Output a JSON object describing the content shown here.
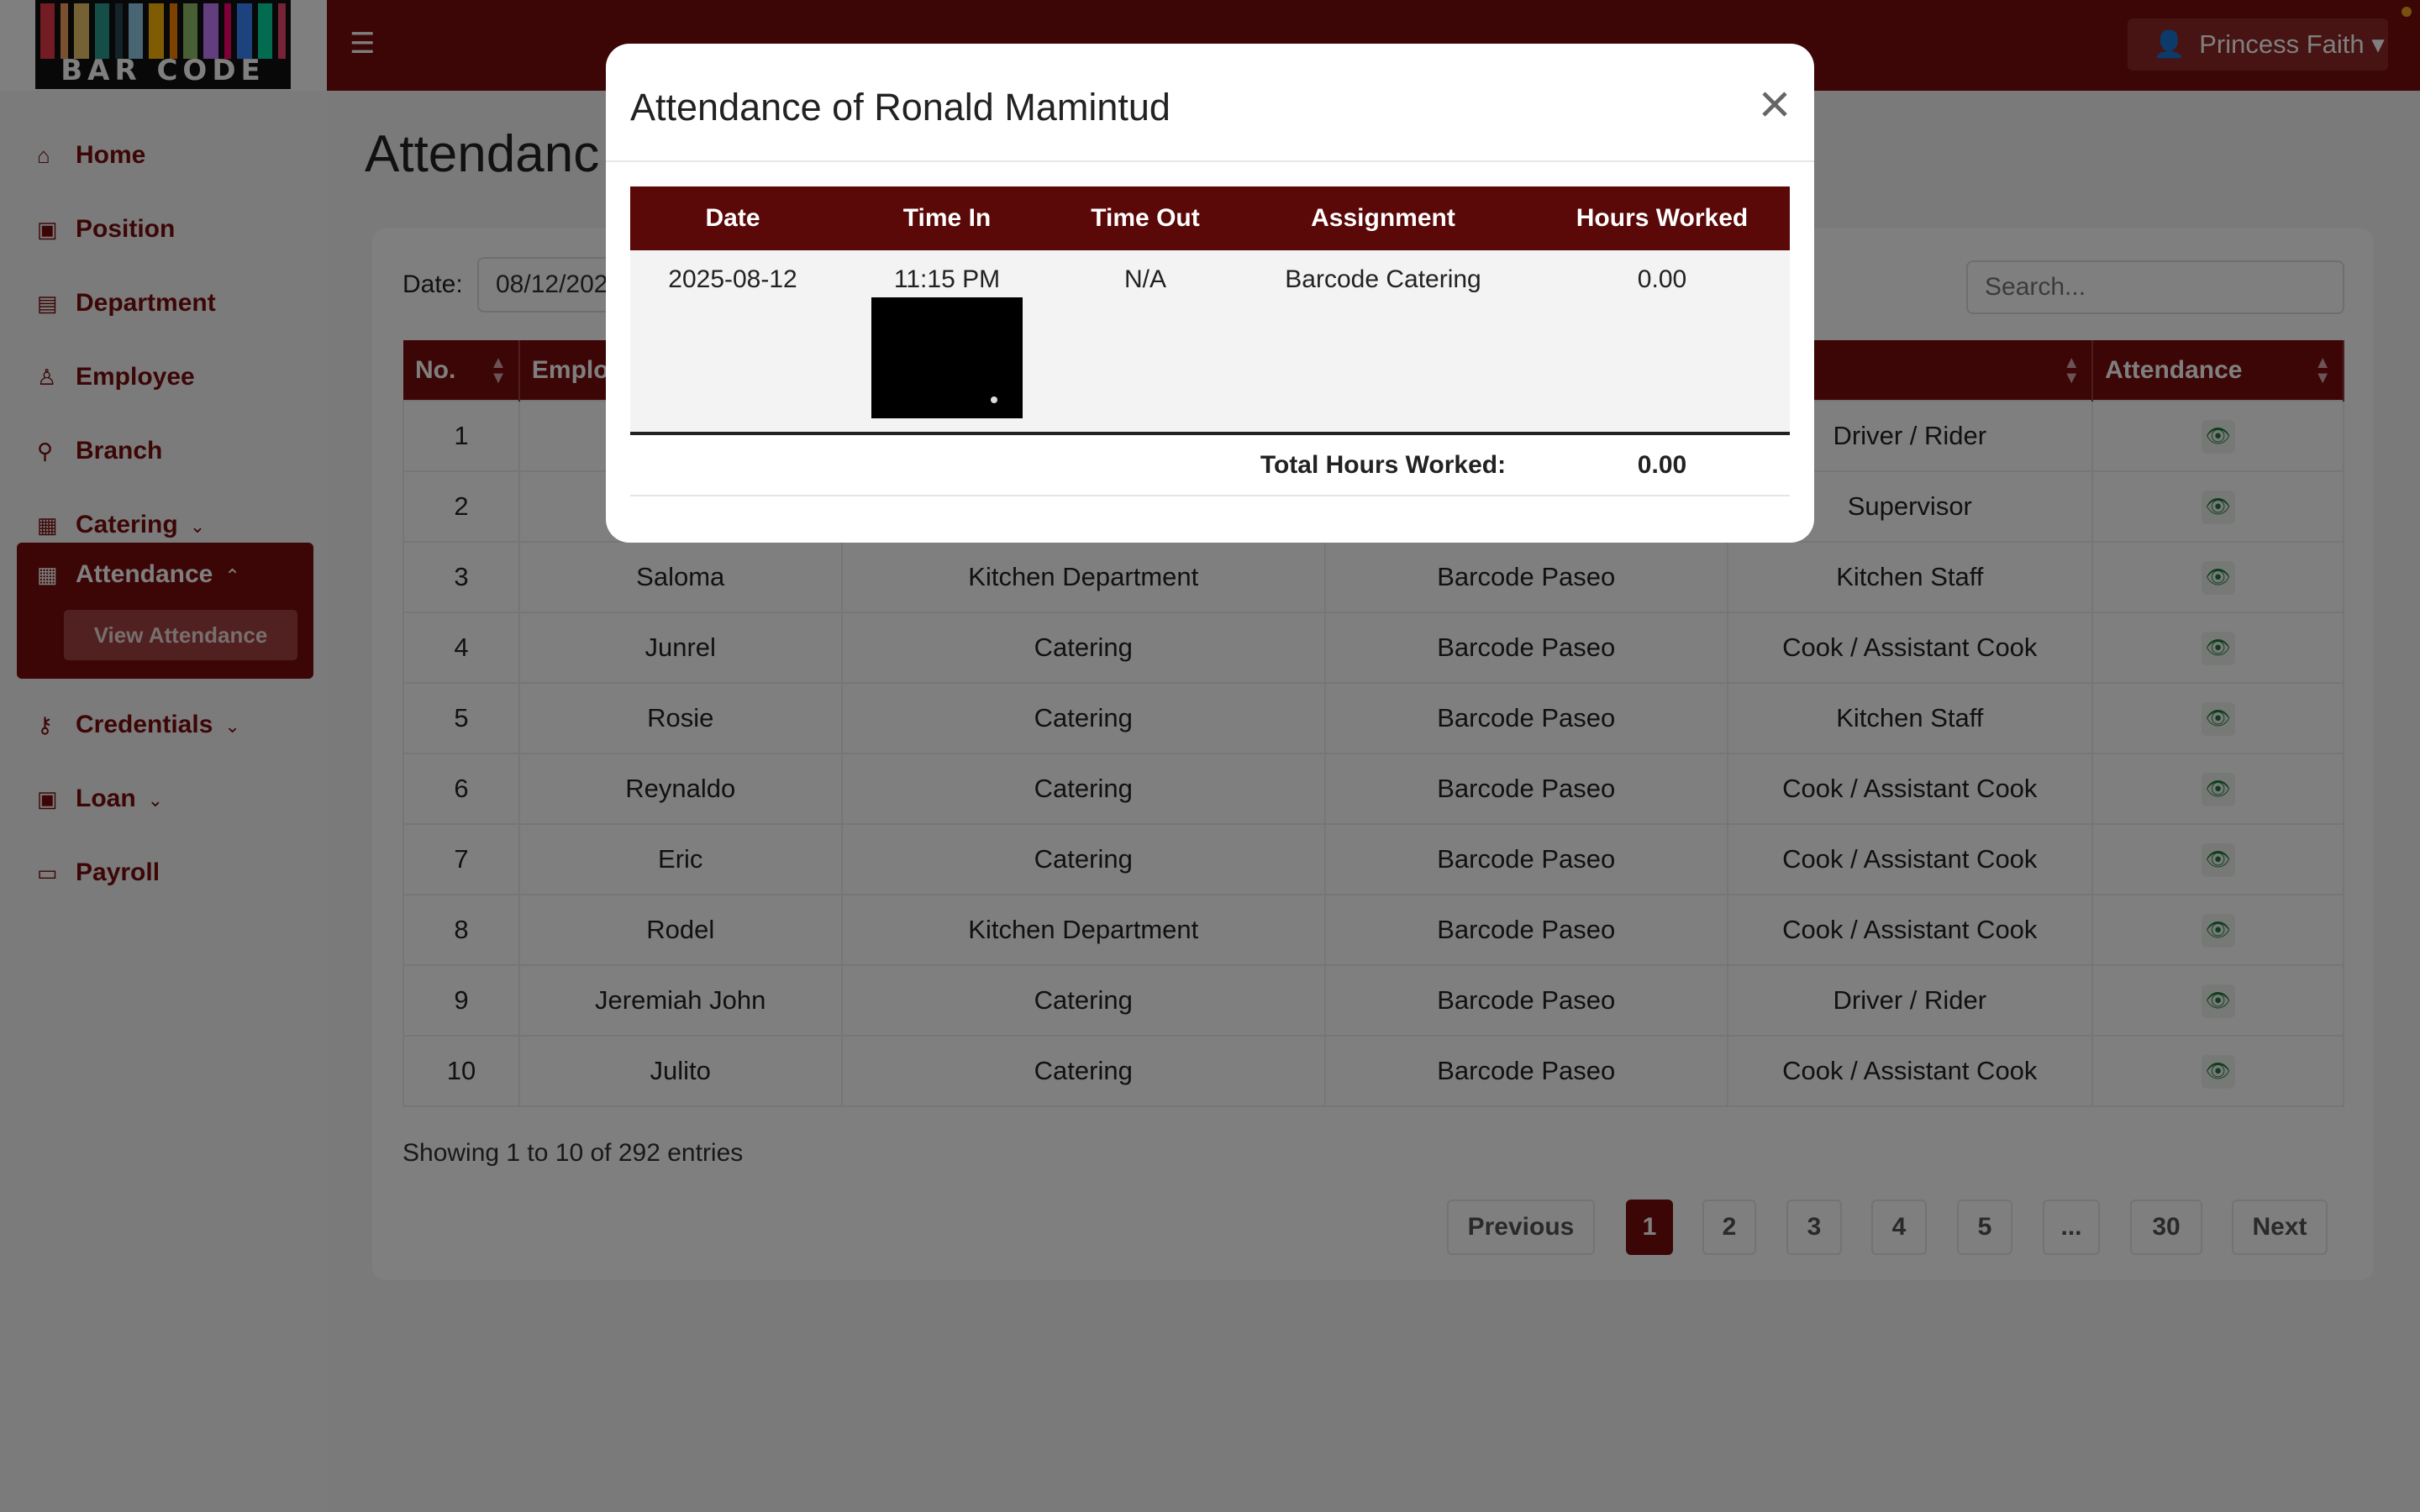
{
  "app": {
    "logo_text": "BAR CODE",
    "logo_colors": [
      "#e63946",
      "#f4a261",
      "#e9c46a",
      "#2a9d8f",
      "#264653",
      "#8ecae6",
      "#ffb703",
      "#fb8500",
      "#90be6d",
      "#c77dff",
      "#ff006e",
      "#3a86ff",
      "#06d6a0",
      "#ef476f"
    ],
    "accent": "#7a0c0c",
    "user_name": "Princess Faith"
  },
  "sidebar": {
    "items": [
      {
        "label": "Home",
        "icon": "home-icon"
      },
      {
        "label": "Position",
        "icon": "badge-icon"
      },
      {
        "label": "Department",
        "icon": "building-icon"
      },
      {
        "label": "Employee",
        "icon": "user-icon"
      },
      {
        "label": "Branch",
        "icon": "branch-icon"
      },
      {
        "label": "Catering",
        "icon": "catering-icon"
      },
      {
        "label": "Attendance",
        "icon": "calendar-icon"
      },
      {
        "label": "Credentials",
        "icon": "key-icon"
      },
      {
        "label": "Loan",
        "icon": "cash-icon"
      },
      {
        "label": "Payroll",
        "icon": "card-icon"
      }
    ],
    "sub_item": "View Attendance"
  },
  "main": {
    "title": "Attendanc",
    "date_label": "Date:",
    "date_value": "08/12/202",
    "search_placeholder": "Search...",
    "columns": [
      "No.",
      "Emplo",
      "",
      "",
      "on",
      "Attendance"
    ],
    "rows": [
      {
        "no": "1",
        "name": "",
        "department": "",
        "branch": "",
        "position": "Driver / Rider"
      },
      {
        "no": "2",
        "name": "",
        "department": "",
        "branch": "",
        "position": "Supervisor"
      },
      {
        "no": "3",
        "name": "Saloma",
        "department": "Kitchen Department",
        "branch": "Barcode Paseo",
        "position": "Kitchen Staff"
      },
      {
        "no": "4",
        "name": "Junrel",
        "department": "Catering",
        "branch": "Barcode Paseo",
        "position": "Cook / Assistant Cook"
      },
      {
        "no": "5",
        "name": "Rosie",
        "department": "Catering",
        "branch": "Barcode Paseo",
        "position": "Kitchen Staff"
      },
      {
        "no": "6",
        "name": "Reynaldo",
        "department": "Catering",
        "branch": "Barcode Paseo",
        "position": "Cook / Assistant Cook"
      },
      {
        "no": "7",
        "name": "Eric",
        "department": "Catering",
        "branch": "Barcode Paseo",
        "position": "Cook / Assistant Cook"
      },
      {
        "no": "8",
        "name": "Rodel",
        "department": "Kitchen Department",
        "branch": "Barcode Paseo",
        "position": "Cook / Assistant Cook"
      },
      {
        "no": "9",
        "name": "Jeremiah John",
        "department": "Catering",
        "branch": "Barcode Paseo",
        "position": "Driver / Rider"
      },
      {
        "no": "10",
        "name": "Julito",
        "department": "Catering",
        "branch": "Barcode Paseo",
        "position": "Cook / Assistant Cook"
      }
    ],
    "entries_info": "Showing 1 to 10 of 292 entries",
    "pagination": [
      "Previous",
      "1",
      "2",
      "3",
      "4",
      "5",
      "...",
      "30",
      "Next"
    ],
    "active_page": "1"
  },
  "modal": {
    "title": "Attendance of Ronald Mamintud",
    "columns": [
      "Date",
      "Time In",
      "Time Out",
      "Assignment",
      "Hours Worked"
    ],
    "record": {
      "date": "2025-08-12",
      "time_in": "11:15 PM",
      "time_out": "N/A",
      "assignment": "Barcode Catering",
      "hours": "0.00"
    },
    "total_label": "Total Hours Worked:",
    "total_value": "0.00"
  }
}
